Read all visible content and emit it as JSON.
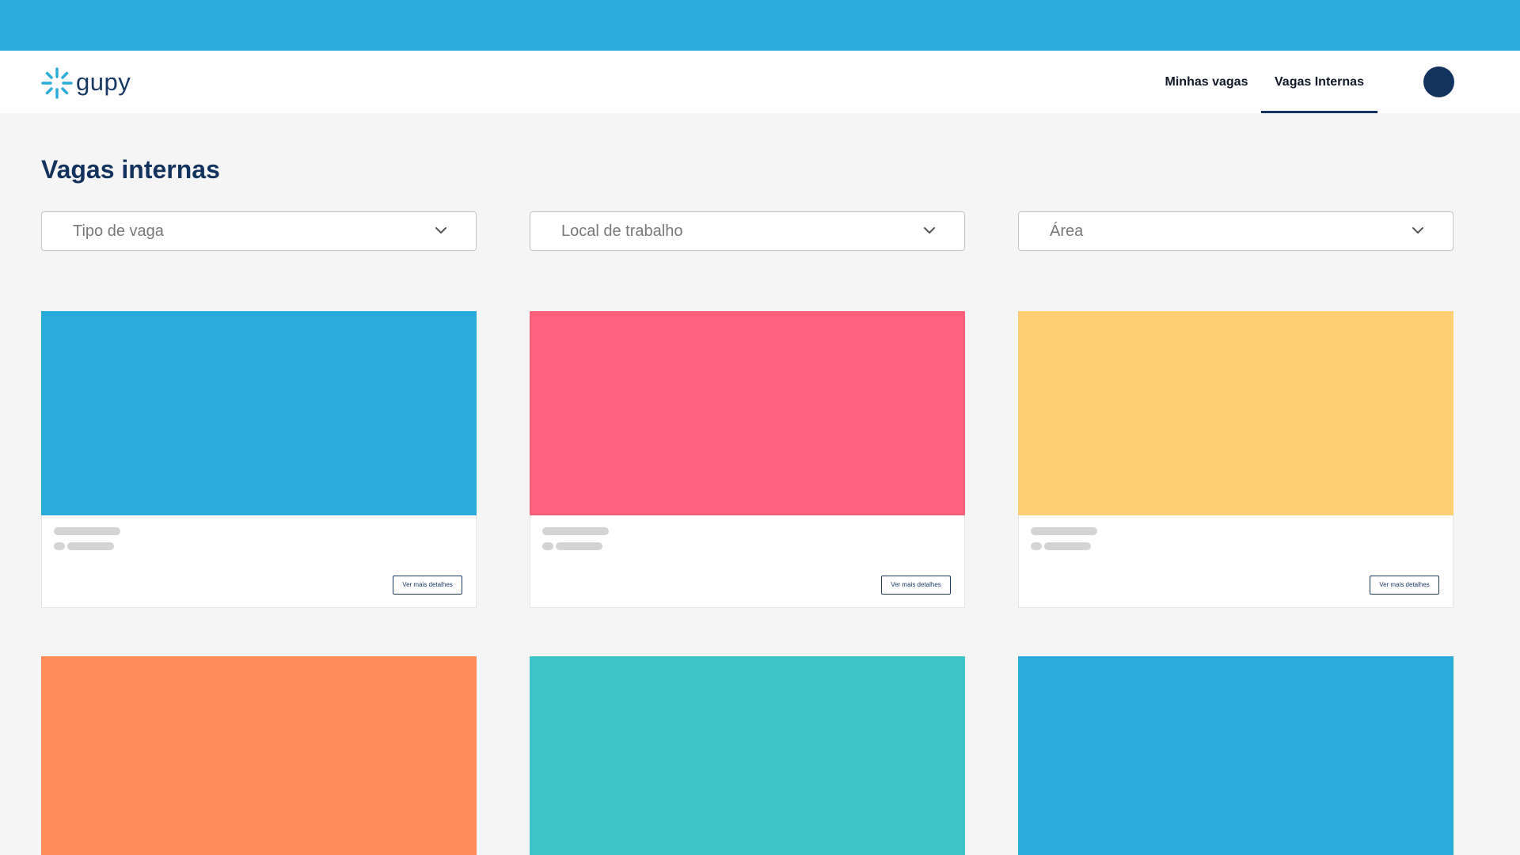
{
  "theme": {
    "top_strip_color": "#29acd9",
    "brand_navy": "#13335f",
    "active_underline": "#13335f",
    "title_color": "#13335f"
  },
  "header": {
    "logo_text": "gupy",
    "logo_icon": "gupy-sparkle-icon",
    "nav": {
      "minhas_vagas": "Minhas vagas",
      "vagas_internas": "Vagas Internas",
      "active": "Vagas Internas"
    },
    "avatar_color": "#13335f"
  },
  "main": {
    "title": "Vagas internas",
    "filters": {
      "tipo": "Tipo de vaga",
      "local": "Local de trabalho",
      "area": "Área"
    },
    "cards": [
      {
        "color": "#29acd9",
        "button": "Ver mais detalhes"
      },
      {
        "color": "#ff607c",
        "button": "Ver mais detalhes"
      },
      {
        "color": "#ffcf73",
        "button": "Ver mais detalhes"
      },
      {
        "color": "#ff8c5a"
      },
      {
        "color": "#3cc5c8"
      },
      {
        "color": "#29acd9"
      }
    ]
  }
}
